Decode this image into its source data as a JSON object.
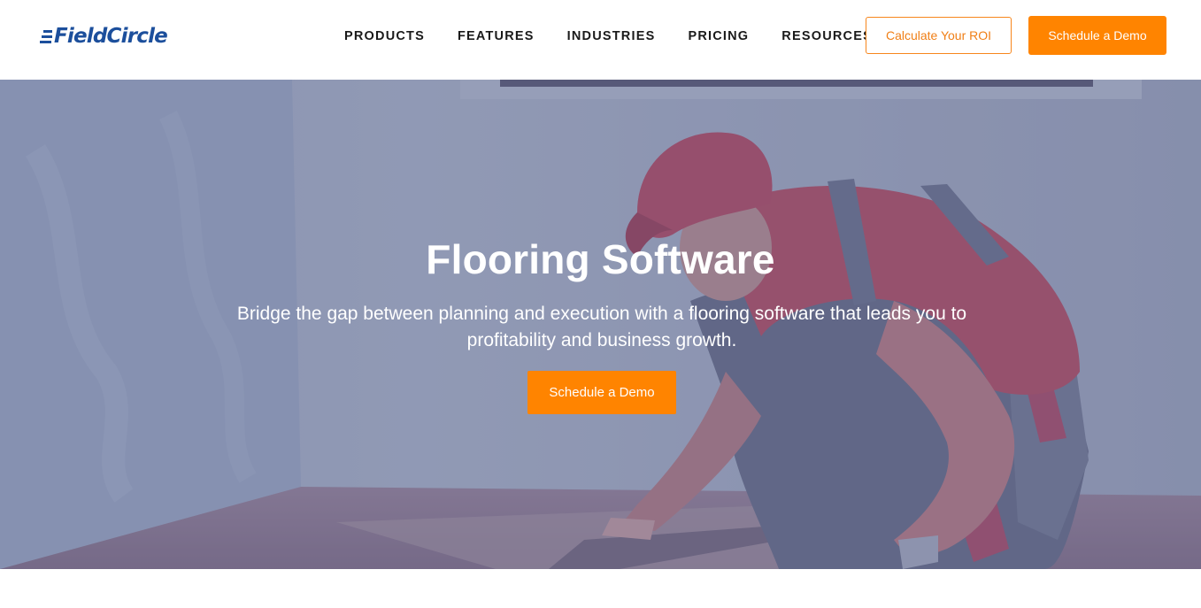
{
  "header": {
    "logo_text": "FieldCircle",
    "nav": [
      "PRODUCTS",
      "FEATURES",
      "INDUSTRIES",
      "PRICING",
      "RESOURCES"
    ],
    "roi_button": "Calculate Your ROI",
    "demo_button": "Schedule a Demo"
  },
  "hero": {
    "title": "Flooring Software",
    "subtitle": "Bridge the gap between planning and execution with a flooring software that leads you to profitability and business growth.",
    "cta": "Schedule a Demo",
    "image": "worker-laying-flooring-photo"
  },
  "colors": {
    "brand_blue": "#1c4f9c",
    "accent_orange": "#ff8400",
    "overlay": "#4e5c8a"
  }
}
